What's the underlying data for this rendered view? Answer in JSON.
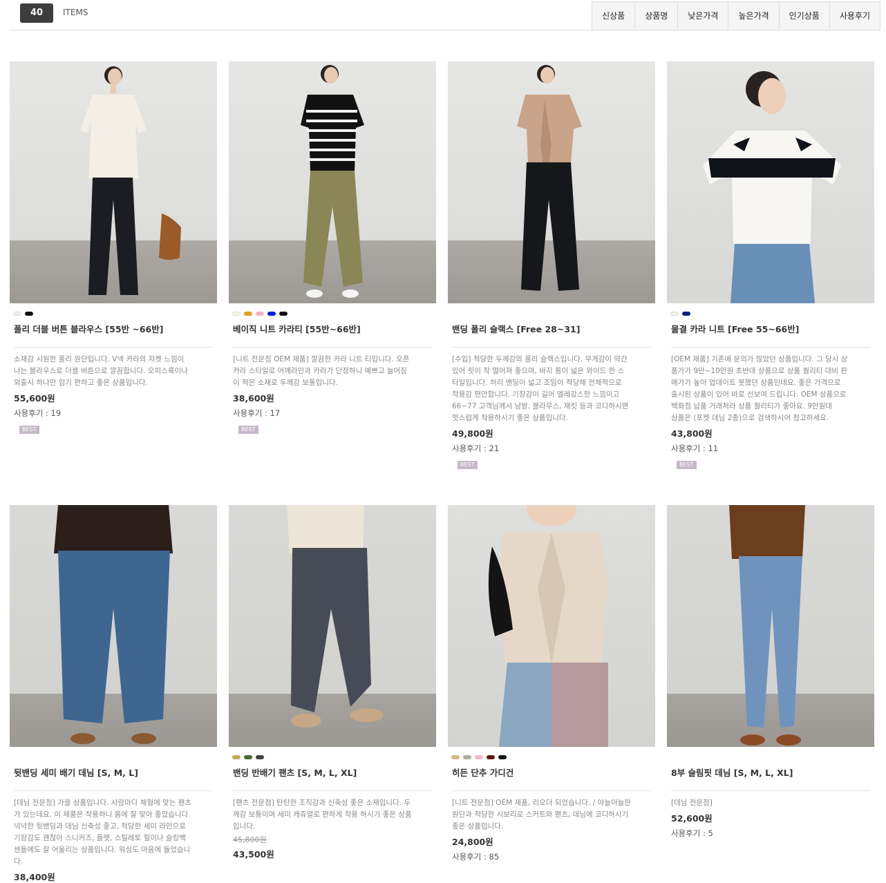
{
  "header": {
    "count": "40",
    "items_label": "ITEMS",
    "sort_tabs": [
      "신상품",
      "상품명",
      "낮은가격",
      "높은가격",
      "인기상품",
      "사용후기"
    ]
  },
  "products": [
    {
      "name": "폴리 더블 버튼 블라우스 [55반 ~66반]",
      "swatches": [
        "#f0ede6",
        "#111111"
      ],
      "desc": [
        "소재감 시원한 폴리 원단입니다. V넥 카라의 자켓 느낌이",
        "나는 블라우스로 더블 버튼으로 깔끔합니다. 오피스룩이나",
        "외출시 하나만 입기 편하고 좋은 상품입니다."
      ],
      "old_price": "",
      "price": "55,600원",
      "review": "사용후기 : 19",
      "badge": "BEST"
    },
    {
      "name": "베이직 니트 카라티 [55반~66반]",
      "swatches": [
        "#f6f2e6",
        "#e0a020",
        "#f4b3c6",
        "#0a1fd6",
        "#111111"
      ],
      "desc": [
        "[니트 전문점 OEM 제품] 깔끔한 카라 니트 티입니다. 오픈",
        "카라 스타일로 어깨라인과 카라가 단정하니 예쁘고 늘어짐",
        "이 적은 소재로 두께감 보통입니다."
      ],
      "old_price": "",
      "price": "38,600원",
      "review": "사용후기 : 17",
      "badge": "BEST"
    },
    {
      "name": "밴딩 폴리 슬랙스 [Free 28~31]",
      "swatches": [],
      "desc": [
        "[수입] 적당한 두께감의 폴리 슬랙스입니다. 무게감이 약간",
        "있어 핏이 착 떨어져 좋으며, 바지 통이 넓은 와이드 한 스",
        "타일입니다. 허리 밴딩이 넓고 조임이 적당해 전체적으로",
        "착용감 편안합니다. 기장감이 길어 엘레강스한 느낌이고",
        "66~77 고객님께서 남방, 블라우스, 재킷 등과 코디하시면",
        "멋스럽게 착용하시기 좋은 상품입니다."
      ],
      "old_price": "",
      "price": "49,800원",
      "review": "사용후기 : 21",
      "badge": "BEST"
    },
    {
      "name": "물결 카라 니트 [Free 55~66반]",
      "swatches": [
        "#f5f1dc",
        "#0a1f7a"
      ],
      "desc": [
        "[OEM 제품] 기존에 문의가 많았던 상품입니다. 그 당시 상",
        "품가가 9만~10만원 초반대 상품으로 상품 퀄리티 대비 판",
        "매가가 높아 업데이트 못했던 상품인데요. 좋은 가격으로",
        "출시된 상품이 있어 바로 선보여 드립니다. OEM 상품으로",
        "백화점 납품 거래처라 상품 퀄리티가 좋아요. 9만원대",
        "상품은 (포켓 데님 2종)으로 검색하시어 참고하세요."
      ],
      "old_price": "",
      "price": "43,800원",
      "review": "사용후기 : 11",
      "badge": "BEST"
    },
    {
      "name": "뒷밴딩 세미 배기 데님 [S, M, L]",
      "swatches": [],
      "desc": [
        "[데님 전문점] 가을 상품입니다. 사람마다 체형에 맞는 팬츠",
        "가 있는데요. 이 제품은 착용하니 몸에 잘 맞아 좋았습니다.",
        "넉넉한 뒷밴딩과 데님 신축성 좋고, 적당한 세미 라인으로",
        "기장감도 괜찮아 스니커즈, 플랫, 스틸레토 힐이나 슬링백",
        "샌들에도 잘 어울리는 상품입니다. 워싱도 마음에 들었습니",
        "다."
      ],
      "old_price": "",
      "price": "38,400원",
      "review": "",
      "badge": ""
    },
    {
      "name": "밴딩 반배기 팬츠 [S, M, L, XL]",
      "swatches": [
        "#c8a85a",
        "#4a6b3a",
        "#444444"
      ],
      "desc": [
        "[팬츠 전문점] 탄탄한 조직감과 신축성 좋은 소재입니다. 두",
        "께감 보통이며 세미 캐쥬얼로 편하게 착용 하시기 좋은 상품",
        "입니다."
      ],
      "old_price": "45,800원",
      "price": "43,500원",
      "review": "",
      "badge": ""
    },
    {
      "name": "히든 단추 가디건",
      "swatches": [
        "#d6b888",
        "#a8ada0",
        "#f4b8c8",
        "#5a1a10",
        "#111111"
      ],
      "desc": [
        "[니트 전문점] OEM 제품, 리오더 되었습니다. / 아늘아늘한",
        "원단과 적당한 시보리로 스커트와 팬츠, 데님에 코디하시기",
        "좋은 상품입니다."
      ],
      "old_price": "",
      "price": "24,800원",
      "review": "사용후기 : 85",
      "badge": ""
    },
    {
      "name": "8부 슬림핏 데님 [S, M, L, XL]",
      "swatches": [],
      "desc": [
        "[데님 전문점]"
      ],
      "old_price": "",
      "price": "52,600원",
      "review": "사용후기 : 5",
      "badge": ""
    }
  ]
}
